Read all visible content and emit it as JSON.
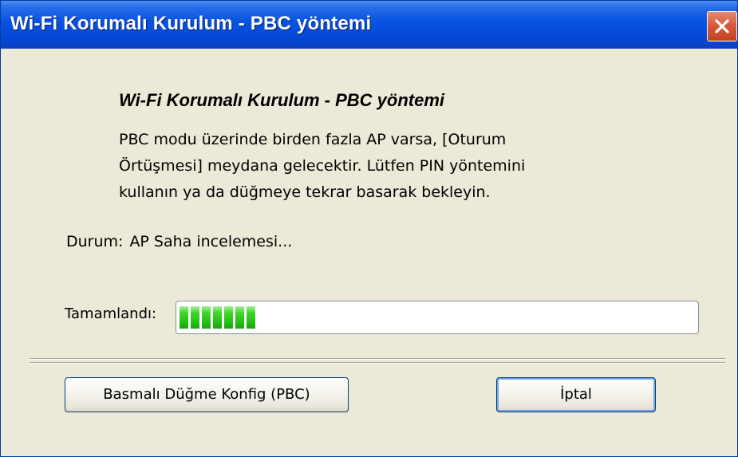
{
  "window": {
    "title": "Wi-Fi Korumalı Kurulum - PBC yöntemi",
    "close_icon": "close-x-icon"
  },
  "content": {
    "heading": "Wi-Fi Korumalı Kurulum - PBC yöntemi",
    "description_lines": [
      "PBC modu üzerinde birden fazla AP varsa, [Oturum",
      "Örtüşmesi] meydana gelecektir. Lütfen PIN yöntemini",
      "kullanın ya da düğmeye tekrar basarak bekleyin."
    ],
    "status_label": "Durum:",
    "status_value": "AP Saha incelemesi...",
    "progress_label": "Tamamlandı:",
    "progress_segments_filled": 7
  },
  "buttons": {
    "pbc_label": "Basmalı Düğme Konfig (PBC)",
    "cancel_label": "İptal"
  },
  "colors": {
    "titlebar": "#0548d7",
    "window_bg": "#ece9d8",
    "progress_green": "#26c116",
    "close_red": "#d75b3c"
  }
}
